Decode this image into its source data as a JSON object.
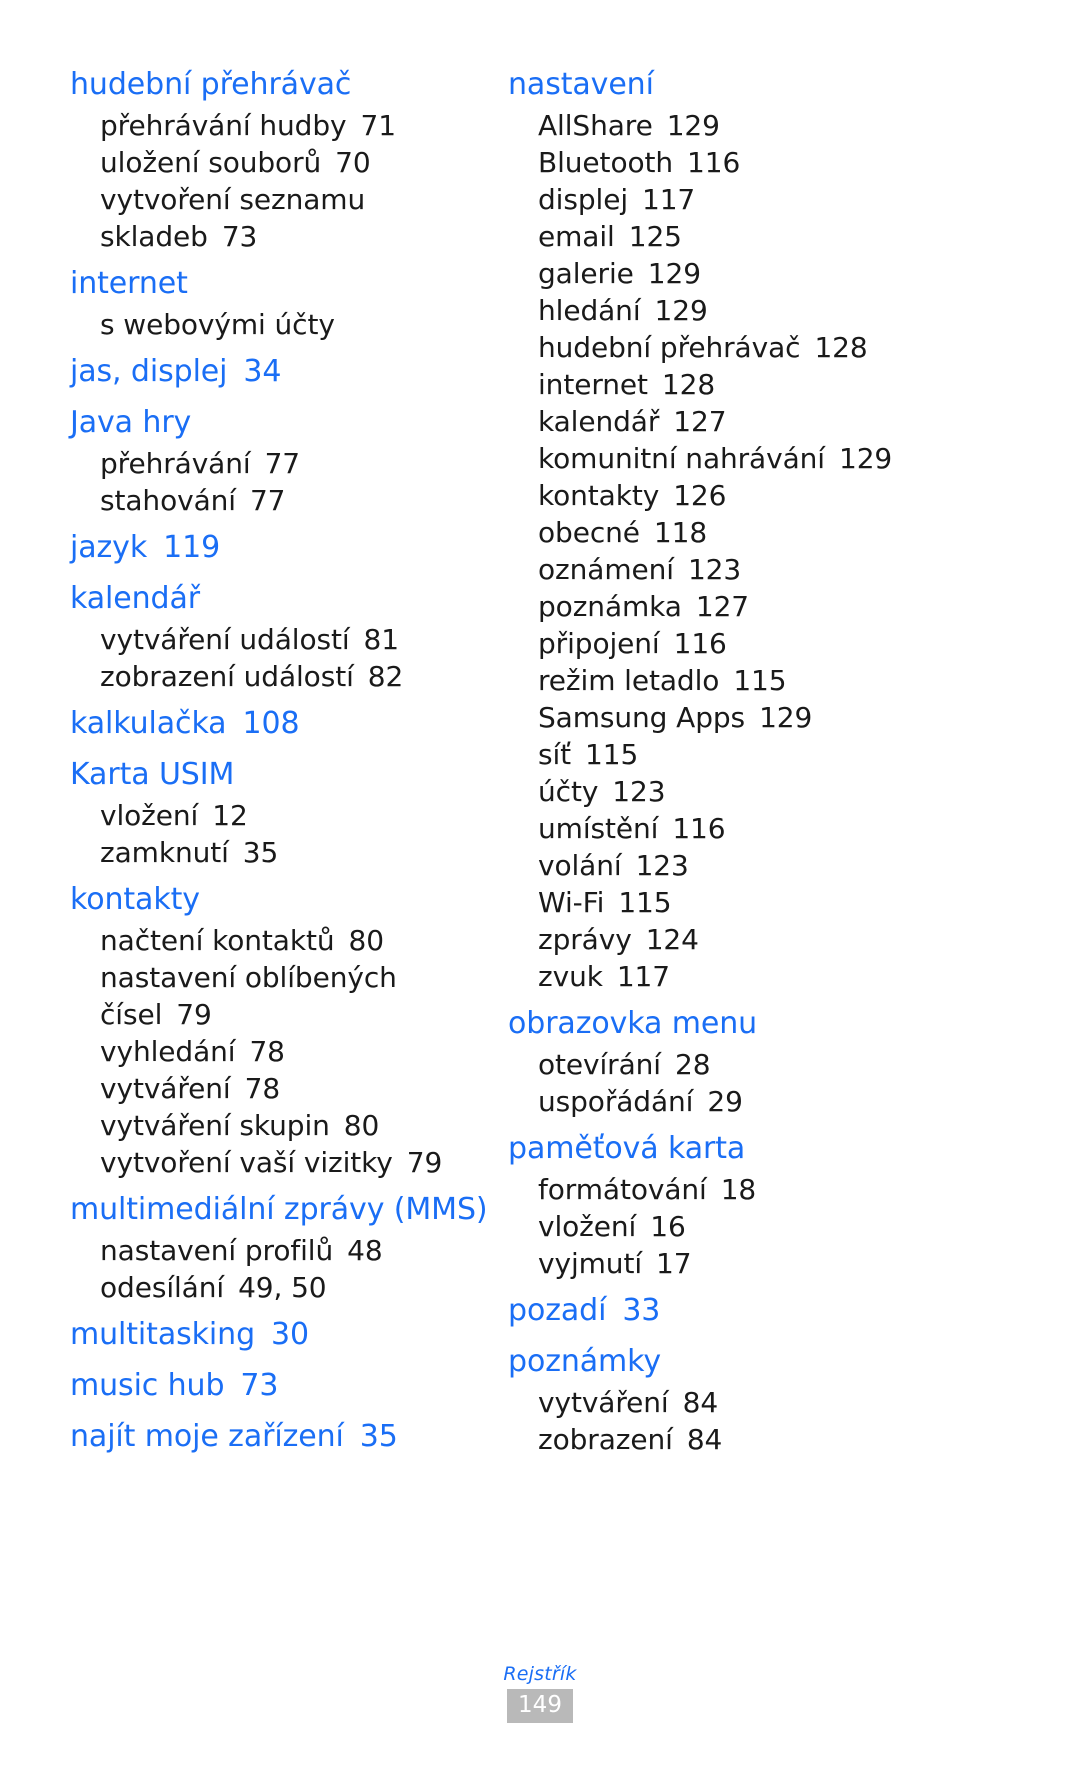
{
  "page": {
    "footer_label": "Rejstřík",
    "page_number": "149",
    "heading_color": "#1a6ef5",
    "body_color": "#1a1a1a",
    "page_box_color": "#b9b9b9"
  },
  "left_column": [
    {
      "heading": "hudební přehrávač",
      "page": "",
      "subs": [
        {
          "label": "přehrávání hudby",
          "page": "71"
        },
        {
          "label": "uložení souborů",
          "page": "70"
        },
        {
          "label": "vytvoření seznamu",
          "page": ""
        },
        {
          "label": "skladeb",
          "page": "73"
        }
      ]
    },
    {
      "heading": "internet",
      "page": "",
      "subs": [
        {
          "label": "s webovými účty",
          "page": ""
        }
      ]
    },
    {
      "heading": "jas, displej",
      "page": "34",
      "subs": []
    },
    {
      "heading": "Java hry",
      "page": "",
      "subs": [
        {
          "label": "přehrávání",
          "page": "77"
        },
        {
          "label": "stahování",
          "page": "77"
        }
      ]
    },
    {
      "heading": "jazyk",
      "page": "119",
      "subs": []
    },
    {
      "heading": "kalendář",
      "page": "",
      "subs": [
        {
          "label": "vytváření událostí",
          "page": "81"
        },
        {
          "label": "zobrazení událostí",
          "page": "82"
        }
      ]
    },
    {
      "heading": "kalkulačka",
      "page": "108",
      "subs": []
    },
    {
      "heading": "Karta USIM",
      "page": "",
      "subs": [
        {
          "label": "vložení",
          "page": "12"
        },
        {
          "label": "zamknutí",
          "page": "35"
        }
      ]
    },
    {
      "heading": "kontakty",
      "page": "",
      "subs": [
        {
          "label": "načtení kontaktů",
          "page": "80"
        },
        {
          "label": "nastavení oblíbených",
          "page": ""
        },
        {
          "label": "čísel",
          "page": "79"
        },
        {
          "label": "vyhledání",
          "page": "78"
        },
        {
          "label": "vytváření",
          "page": "78"
        },
        {
          "label": "vytváření skupin",
          "page": "80"
        },
        {
          "label": "vytvoření vaší vizitky",
          "page": "79"
        }
      ]
    },
    {
      "heading": "multimediální zprávy (MMS)",
      "page": "",
      "subs": [
        {
          "label": "nastavení profilů",
          "page": "48"
        },
        {
          "label": "odesílání",
          "page": "49, 50"
        }
      ]
    },
    {
      "heading": "multitasking",
      "page": "30",
      "subs": []
    },
    {
      "heading": "music hub",
      "page": "73",
      "subs": []
    },
    {
      "heading": "najít moje zařízení",
      "page": "35",
      "subs": []
    }
  ],
  "right_column": [
    {
      "heading": "nastavení",
      "page": "",
      "subs": [
        {
          "label": "AllShare",
          "page": "129"
        },
        {
          "label": "Bluetooth",
          "page": "116"
        },
        {
          "label": "displej",
          "page": "117"
        },
        {
          "label": "email",
          "page": "125"
        },
        {
          "label": "galerie",
          "page": "129"
        },
        {
          "label": "hledání",
          "page": "129"
        },
        {
          "label": "hudební přehrávač",
          "page": "128"
        },
        {
          "label": "internet",
          "page": "128"
        },
        {
          "label": "kalendář",
          "page": "127"
        },
        {
          "label": "komunitní nahrávání",
          "page": "129"
        },
        {
          "label": "kontakty",
          "page": "126"
        },
        {
          "label": "obecné",
          "page": "118"
        },
        {
          "label": "oznámení",
          "page": "123"
        },
        {
          "label": "poznámka",
          "page": "127"
        },
        {
          "label": "připojení",
          "page": "116"
        },
        {
          "label": "režim letadlo",
          "page": "115"
        },
        {
          "label": "Samsung Apps",
          "page": "129"
        },
        {
          "label": "síť",
          "page": "115"
        },
        {
          "label": "účty",
          "page": "123"
        },
        {
          "label": "umístění",
          "page": "116"
        },
        {
          "label": "volání",
          "page": "123"
        },
        {
          "label": "Wi-Fi",
          "page": "115"
        },
        {
          "label": "zprávy",
          "page": "124"
        },
        {
          "label": "zvuk",
          "page": "117"
        }
      ]
    },
    {
      "heading": "obrazovka menu",
      "page": "",
      "subs": [
        {
          "label": "otevírání",
          "page": "28"
        },
        {
          "label": "uspořádání",
          "page": "29"
        }
      ]
    },
    {
      "heading": "paměťová karta",
      "page": "",
      "subs": [
        {
          "label": "formátování",
          "page": "18"
        },
        {
          "label": "vložení",
          "page": "16"
        },
        {
          "label": "vyjmutí",
          "page": "17"
        }
      ]
    },
    {
      "heading": "pozadí",
      "page": "33",
      "subs": []
    },
    {
      "heading": "poznámky",
      "page": "",
      "subs": [
        {
          "label": "vytváření",
          "page": "84"
        },
        {
          "label": "zobrazení",
          "page": "84"
        }
      ]
    }
  ]
}
